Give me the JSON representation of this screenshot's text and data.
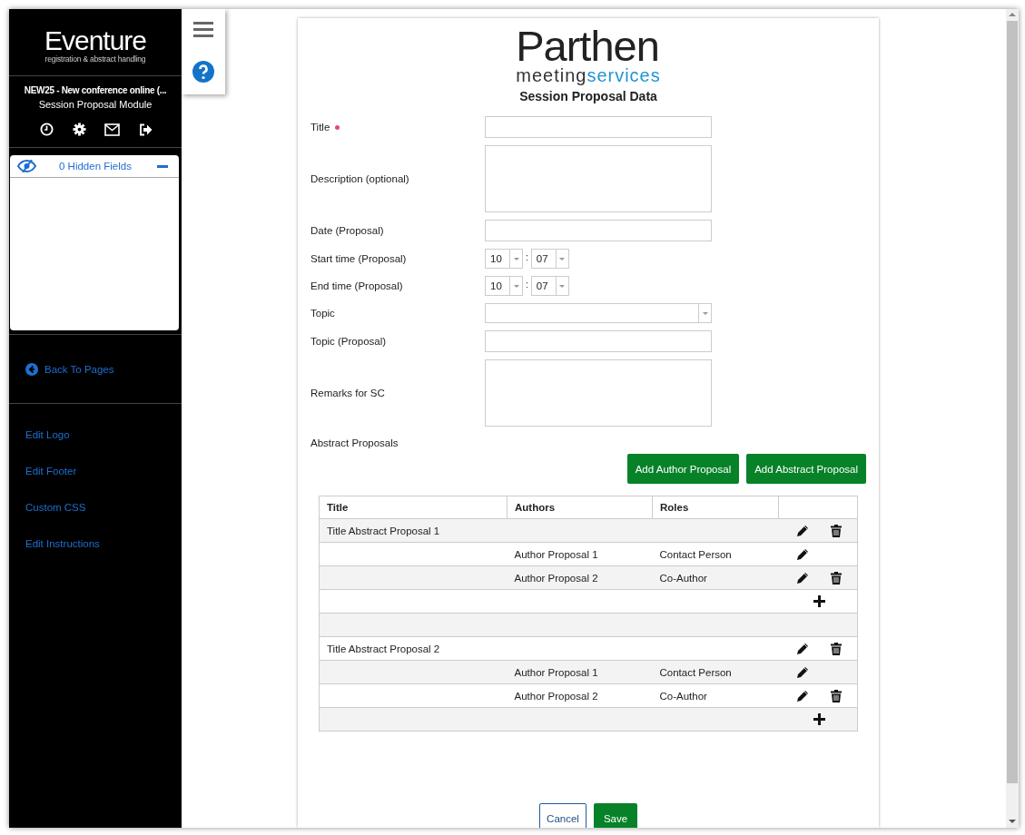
{
  "sidebar": {
    "logo": {
      "name": "Eventure",
      "tagline": "registration & abstract handling"
    },
    "event_title": "NEW25 - New conference online (...",
    "module": "Session Proposal Module",
    "hidden_fields": {
      "label": "0 Hidden Fields",
      "expanded": true
    },
    "back_link": "Back To Pages",
    "links": [
      "Edit Logo",
      "Edit Footer",
      "Custom CSS",
      "Edit Instructions"
    ]
  },
  "form": {
    "logo": {
      "word": "Parthen",
      "sub_dark": "meeting",
      "sub_light": "services"
    },
    "heading": "Session Proposal Data",
    "fields": [
      {
        "kind": "text",
        "label": "Title",
        "required": true
      },
      {
        "kind": "textarea",
        "label": "Description (optional)",
        "required": false
      },
      {
        "kind": "text",
        "label": "Date (Proposal)",
        "required": false
      },
      {
        "kind": "time",
        "label": "Start time (Proposal)",
        "required": false,
        "hour": "10",
        "separator": ":",
        "minute": "07"
      },
      {
        "kind": "time",
        "label": "End time (Proposal)",
        "required": false,
        "hour": "10",
        "separator": ":",
        "minute": "07"
      },
      {
        "kind": "select",
        "label": "Topic",
        "required": false
      },
      {
        "kind": "text",
        "label": "Topic (Proposal)",
        "required": false
      },
      {
        "kind": "textarea",
        "label": "Remarks for SC",
        "required": false
      }
    ],
    "abstracts_label": "Abstract Proposals",
    "add_buttons": [
      "Add Author Proposal",
      "Add Abstract Proposal"
    ],
    "table": {
      "columns": [
        "Title",
        "Authors",
        "Roles"
      ],
      "rows": [
        {
          "kind": "abstract",
          "title": "Title Abstract Proposal 1",
          "deletable": true
        },
        {
          "kind": "author",
          "author": "Author Proposal 1",
          "role": "Contact Person",
          "deletable": false
        },
        {
          "kind": "author",
          "author": "Author Proposal 2",
          "role": "Co-Author",
          "deletable": true
        },
        {
          "kind": "add"
        },
        {
          "kind": "spacer"
        },
        {
          "kind": "abstract",
          "title": "Title Abstract Proposal 2",
          "deletable": true
        },
        {
          "kind": "author",
          "author": "Author Proposal 1",
          "role": "Contact Person",
          "deletable": false
        },
        {
          "kind": "author",
          "author": "Author Proposal 2",
          "role": "Co-Author",
          "deletable": true
        },
        {
          "kind": "add"
        }
      ]
    },
    "cancel": "Cancel",
    "save": "Save"
  }
}
